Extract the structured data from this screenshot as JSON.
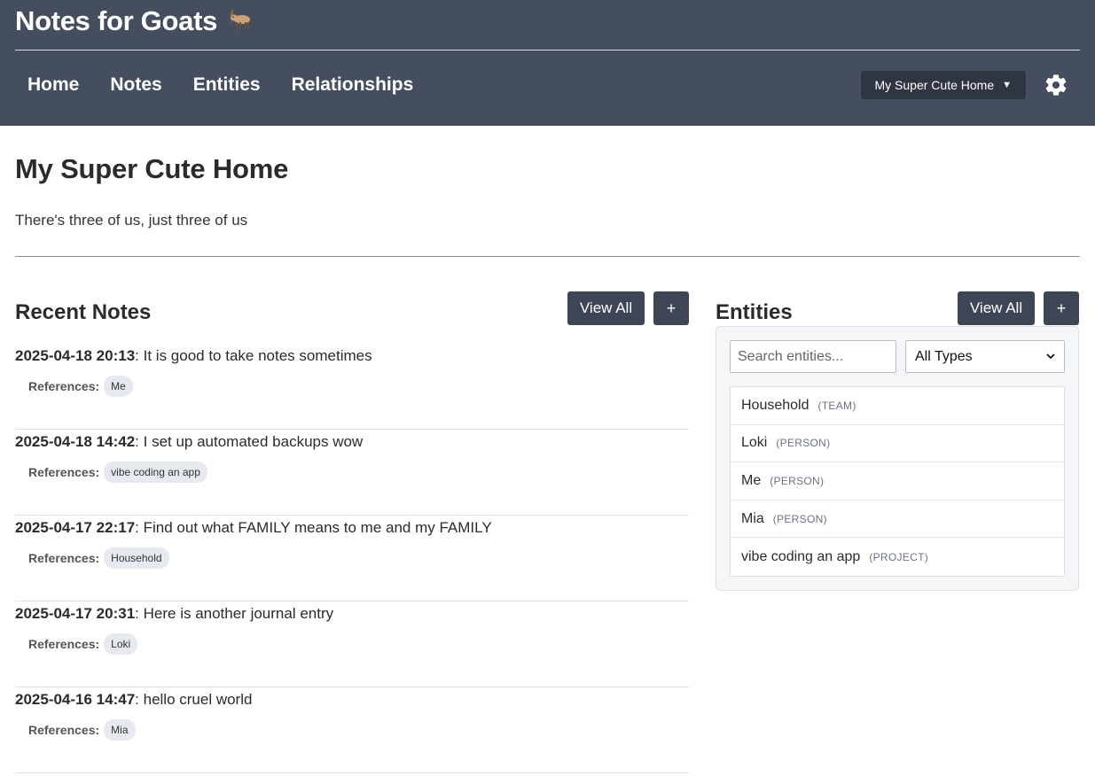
{
  "header": {
    "app_title": "Notes for Goats",
    "nav": [
      {
        "label": "Home"
      },
      {
        "label": "Notes"
      },
      {
        "label": "Entities"
      },
      {
        "label": "Relationships"
      }
    ],
    "project_selector": {
      "value": "My Super Cute Home",
      "caret": "▼"
    },
    "settings_icon": "gear-icon",
    "colors": {
      "header_bg": "#454e5f",
      "button_bg": "#3e4656"
    }
  },
  "page": {
    "title": "My Super Cute Home",
    "description": "There's three of us, just three of us"
  },
  "recent_notes": {
    "title": "Recent Notes",
    "view_all_label": "View All",
    "add_label": "+",
    "references_label": "References:",
    "items": [
      {
        "date": "2025-04-18 20:13",
        "text": ": It is good to take notes sometimes",
        "refs": [
          "Me"
        ]
      },
      {
        "date": "2025-04-18 14:42",
        "text": ": I set up automated backups wow",
        "refs": [
          "vibe coding an app"
        ]
      },
      {
        "date": "2025-04-17 22:17",
        "text": ": Find out what FAMILY means to me and my FAMILY",
        "refs": [
          "Household"
        ]
      },
      {
        "date": "2025-04-17 20:31",
        "text": ": Here is another journal entry",
        "refs": [
          "Loki"
        ]
      },
      {
        "date": "2025-04-16 14:47",
        "text": ": hello cruel world",
        "refs": [
          "Mia"
        ]
      }
    ]
  },
  "entities": {
    "title": "Entities",
    "view_all_label": "View All",
    "add_label": "+",
    "search_placeholder": "Search entities...",
    "type_filter": "All Types",
    "items": [
      {
        "name": "Household",
        "type": "(TEAM)"
      },
      {
        "name": "Loki",
        "type": "(PERSON)"
      },
      {
        "name": "Me",
        "type": "(PERSON)"
      },
      {
        "name": "Mia",
        "type": "(PERSON)"
      },
      {
        "name": "vibe coding an app",
        "type": "(PROJECT)"
      }
    ]
  }
}
